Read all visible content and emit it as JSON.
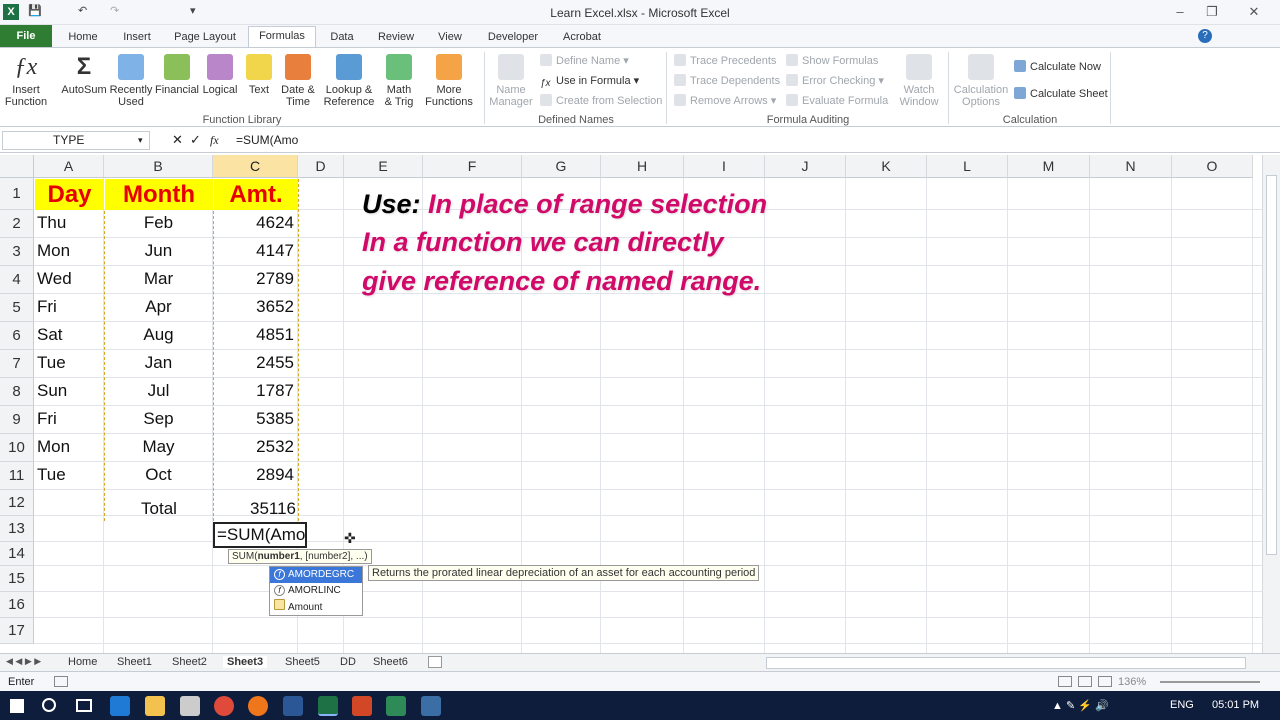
{
  "window": {
    "title": "Learn Excel.xlsx - Microsoft Excel"
  },
  "tabs": [
    "File",
    "Home",
    "Insert",
    "Page Layout",
    "Formulas",
    "Data",
    "Review",
    "View",
    "Developer",
    "Acrobat"
  ],
  "ribbon": {
    "function_library": {
      "group_label": "Function Library",
      "insert_function": "Insert\nFunction",
      "autosum": "AutoSum",
      "recently_used": "Recently\nUsed",
      "financial": "Financial",
      "logical": "Logical",
      "text": "Text",
      "date_time": "Date &\nTime",
      "lookup_reference": "Lookup &\nReference",
      "math_trig": "Math\n& Trig",
      "more_functions": "More\nFunctions"
    },
    "defined_names": {
      "group_label": "Defined Names",
      "name_manager": "Name\nManager",
      "define_name": "Define Name",
      "use_in_formula": "Use in Formula",
      "create_from_selection": "Create from Selection"
    },
    "formula_auditing": {
      "group_label": "Formula Auditing",
      "trace_precedents": "Trace Precedents",
      "trace_dependents": "Trace Dependents",
      "remove_arrows": "Remove Arrows",
      "show_formulas": "Show Formulas",
      "error_checking": "Error Checking",
      "evaluate_formula": "Evaluate Formula",
      "watch_window": "Watch\nWindow"
    },
    "calculation": {
      "group_label": "Calculation",
      "calculation_options": "Calculation\nOptions",
      "calculate_now": "Calculate Now",
      "calculate_sheet": "Calculate Sheet"
    }
  },
  "formula_bar": {
    "name_box": "TYPE",
    "fx": "fx",
    "formula": "=SUM(Amo"
  },
  "columns": [
    "A",
    "B",
    "C",
    "D",
    "E",
    "F",
    "G",
    "H",
    "I",
    "J",
    "K",
    "L",
    "M",
    "N",
    "O"
  ],
  "rows": [
    "1",
    "2",
    "3",
    "4",
    "5",
    "6",
    "7",
    "8",
    "9",
    "10",
    "11",
    "12",
    "13",
    "14",
    "15",
    "16",
    "17"
  ],
  "table": {
    "headers": [
      "Day",
      "Month",
      "Amt."
    ],
    "rows": [
      [
        "Thu",
        "Feb",
        "4624"
      ],
      [
        "Mon",
        "Jun",
        "4147"
      ],
      [
        "Wed",
        "Mar",
        "2789"
      ],
      [
        "Fri",
        "Apr",
        "3652"
      ],
      [
        "Sat",
        "Aug",
        "4851"
      ],
      [
        "Tue",
        "Jan",
        "2455"
      ],
      [
        "Sun",
        "Jul",
        "1787"
      ],
      [
        "Fri",
        "Sep",
        "5385"
      ],
      [
        "Mon",
        "May",
        "2532"
      ],
      [
        "Tue",
        "Oct",
        "2894"
      ]
    ],
    "total_label": "Total",
    "total_value": "35116",
    "editing_cell": "=SUM(Amo"
  },
  "note": {
    "use_label": "Use:",
    "line1": "In place of range selection",
    "line2": "In  a  function  we  can  directly",
    "line3": "give reference of named range."
  },
  "tooltip": {
    "syntax_prefix": "SUM(",
    "syntax_bold": "number1",
    "syntax_rest": ", [number2], ...)",
    "description": "Returns the prorated linear depreciation of an asset for each accounting period"
  },
  "autocomplete": [
    "AMORDEGRC",
    "AMORLINC",
    "Amount"
  ],
  "sheet_tabs": [
    "Home",
    "Sheet1",
    "Sheet2",
    "Sheet3",
    "Sheet5",
    "DD",
    "Sheet6"
  ],
  "active_sheet": "Sheet3",
  "status": {
    "mode": "Enter",
    "zoom": "136%"
  },
  "taskbar": {
    "lang": "ENG",
    "time": "05:01 PM"
  },
  "colors": {
    "accent_green": "#2f7d32",
    "header_yellow": "#ffff00",
    "header_red": "#e60000",
    "note_pink": "#d10a6a"
  }
}
